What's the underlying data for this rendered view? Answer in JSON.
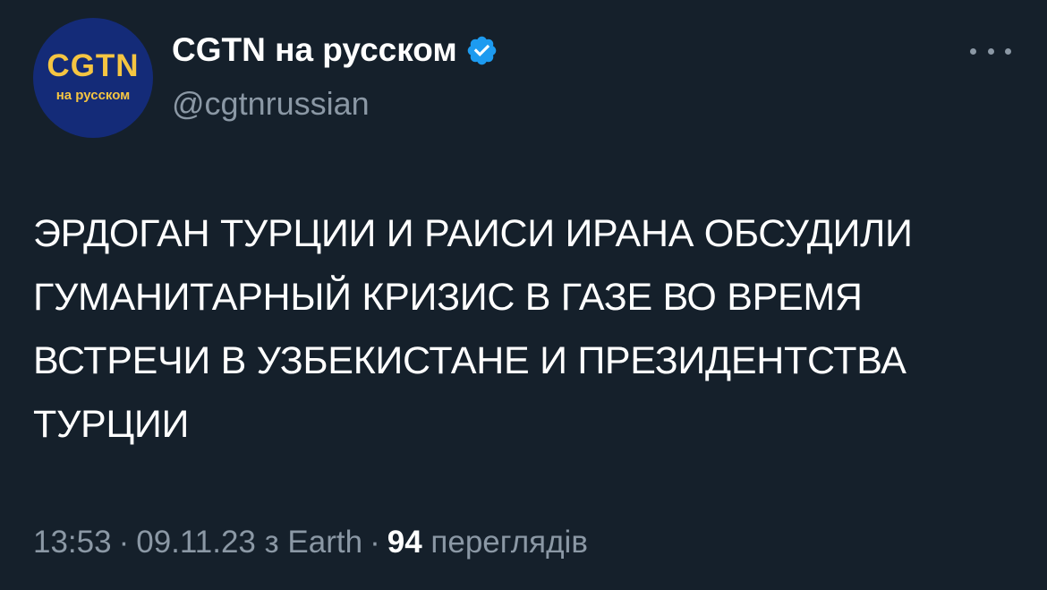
{
  "author": {
    "avatar_text": "CGTN",
    "avatar_subtext": "на русском",
    "display_name": "CGTN на русском",
    "handle": "@cgtnrussian",
    "verified_icon": "verified-badge-icon"
  },
  "menu": {
    "icon": "more-options-icon"
  },
  "tweet": {
    "text": "ЭРДОГАН ТУРЦИИ И РАИСИ ИРАНА ОБСУДИЛИ ГУМАНИТАРНЫЙ КРИЗИС В ГАЗЕ ВО ВРЕМЯ ВСТРЕЧИ В УЗБЕКИСТАНЕ И ПРЕЗИДЕНТСТВА ТУРЦИИ"
  },
  "meta": {
    "time": "13:53",
    "date": "09.11.23",
    "source": "з Earth",
    "views_count": "94",
    "views_label": "переглядів",
    "separator": "·"
  },
  "colors": {
    "background": "#15202b",
    "text": "#ffffff",
    "muted": "#8b98a5",
    "verified": "#1d9bf0",
    "avatar_bg": "#142b78",
    "avatar_text": "#f5c542"
  }
}
